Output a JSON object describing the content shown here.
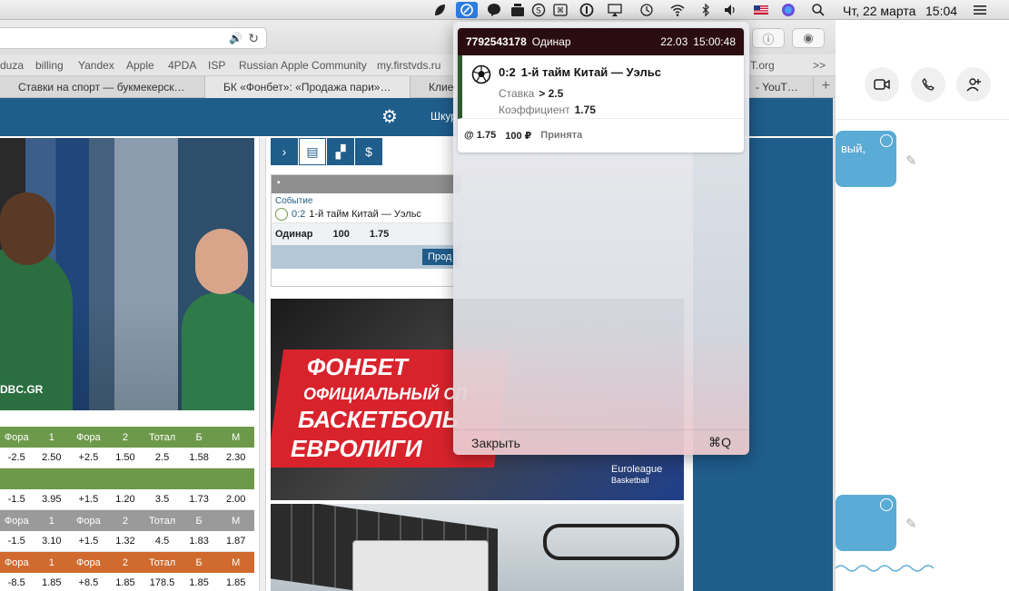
{
  "menubar": {
    "date": "Чт, 22 марта",
    "time": "15:04"
  },
  "browser": {
    "bookmarks": [
      "duza",
      "billing",
      "Yandex",
      "Apple",
      "4PDA",
      "ISP",
      "Russian Apple Community",
      "my.firstvds.ru",
      "T.org",
      ">>"
    ],
    "tabs": [
      "Ставки на спорт — букмекерск…",
      "БК «Фонбет»: «Продажа пари»…",
      "Клиен",
      "- YouT…"
    ]
  },
  "site": {
    "header_lang": "Шкур",
    "photo_caption": "DBC.GR",
    "odds_header": [
      "Фора",
      "1",
      "Фора",
      "2",
      "Тотал",
      "Б",
      "М"
    ],
    "odds_rows": [
      {
        "style": "green",
        "cells": [
          "Фора",
          "1",
          "Фора",
          "2",
          "Тотал",
          "Б",
          "М"
        ]
      },
      {
        "style": "vals",
        "cells": [
          "-2.5",
          "2.50",
          "+2.5",
          "1.50",
          "2.5",
          "1.58",
          "2.30"
        ]
      },
      {
        "style": "green",
        "cells": [
          "",
          "",
          "",
          "",
          "",
          "",
          ""
        ]
      },
      {
        "style": "vals",
        "cells": [
          "-1.5",
          "3.95",
          "+1.5",
          "1.20",
          "3.5",
          "1.73",
          "2.00"
        ]
      },
      {
        "style": "gray",
        "cells": [
          "Фора",
          "1",
          "Фора",
          "2",
          "Тотал",
          "Б",
          "М"
        ]
      },
      {
        "style": "vals",
        "cells": [
          "-1.5",
          "3.10",
          "+1.5",
          "1.32",
          "4.5",
          "1.83",
          "1.87"
        ]
      },
      {
        "style": "orange",
        "cells": [
          "Фора",
          "1",
          "Фора",
          "2",
          "Тотал",
          "Б",
          "М"
        ]
      },
      {
        "style": "vals",
        "cells": [
          "-8.5",
          "1.85",
          "+8.5",
          "1.85",
          "178.5",
          "1.85",
          "1.85"
        ]
      }
    ],
    "coupon": {
      "section_label": "Событие",
      "score": "0:2",
      "event": "1-й тайм Китай — Уэльс",
      "bet_type": "Одинар",
      "amount": "100",
      "coef": "1.75",
      "button": "Прод"
    },
    "banner": {
      "line1": "ФОНБЕТ",
      "line2": "ОФИЦИАЛЬНЫЙ СП",
      "line3": "БАСКЕТБОЛЬ",
      "line4": "ЕВРОЛИГИ",
      "euro1": "Euroleague",
      "euro2": "Basketball"
    }
  },
  "rightapp": {
    "bubble1_text": "вый,"
  },
  "popup": {
    "bet_id": "7792543178",
    "bet_type": "Одинар",
    "date": "22.03",
    "time": "15:00:48",
    "score": "0:2",
    "event": "1-й тайм Китай — Уэльс",
    "stake_label": "Ставка",
    "stake_value": "> 2.5",
    "coef_label": "Коэффициент",
    "coef_value": "1.75",
    "footer_coef": "@ 1.75",
    "footer_amount": "100 ₽",
    "footer_status": "Принята",
    "close_label": "Закрыть",
    "shortcut": "⌘Q"
  }
}
